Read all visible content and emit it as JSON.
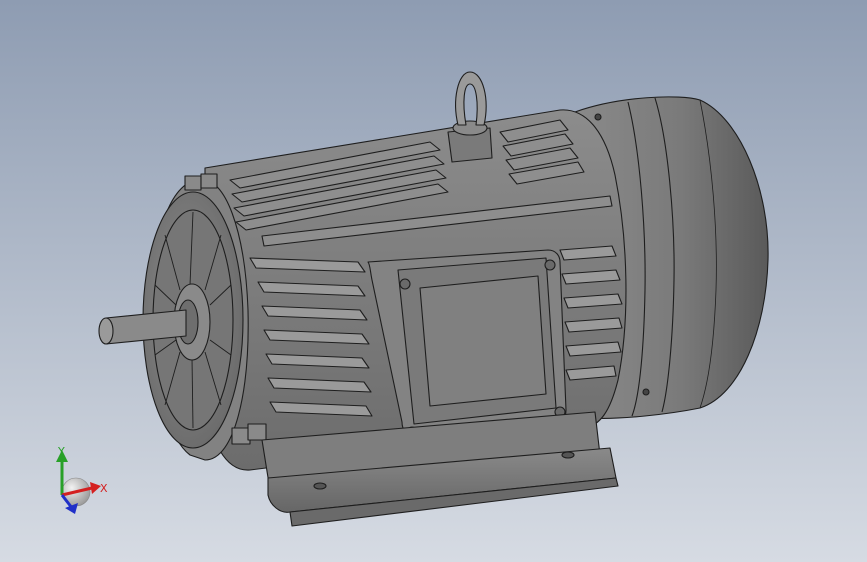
{
  "colors": {
    "background_top": "#8e9cb2",
    "background_bottom": "#d4d9e2",
    "body": "#7d7d7d",
    "body_dark": "#5f5f5f",
    "body_light": "#a3a3a3",
    "edge": "#1e1e1e",
    "axis_x": "#d42020",
    "axis_y": "#28a028",
    "axis_z": "#2030c8"
  },
  "triad": {
    "x_label": "X",
    "y_label": "Y"
  },
  "icons": {
    "triad": "coordinate-triad-icon"
  }
}
